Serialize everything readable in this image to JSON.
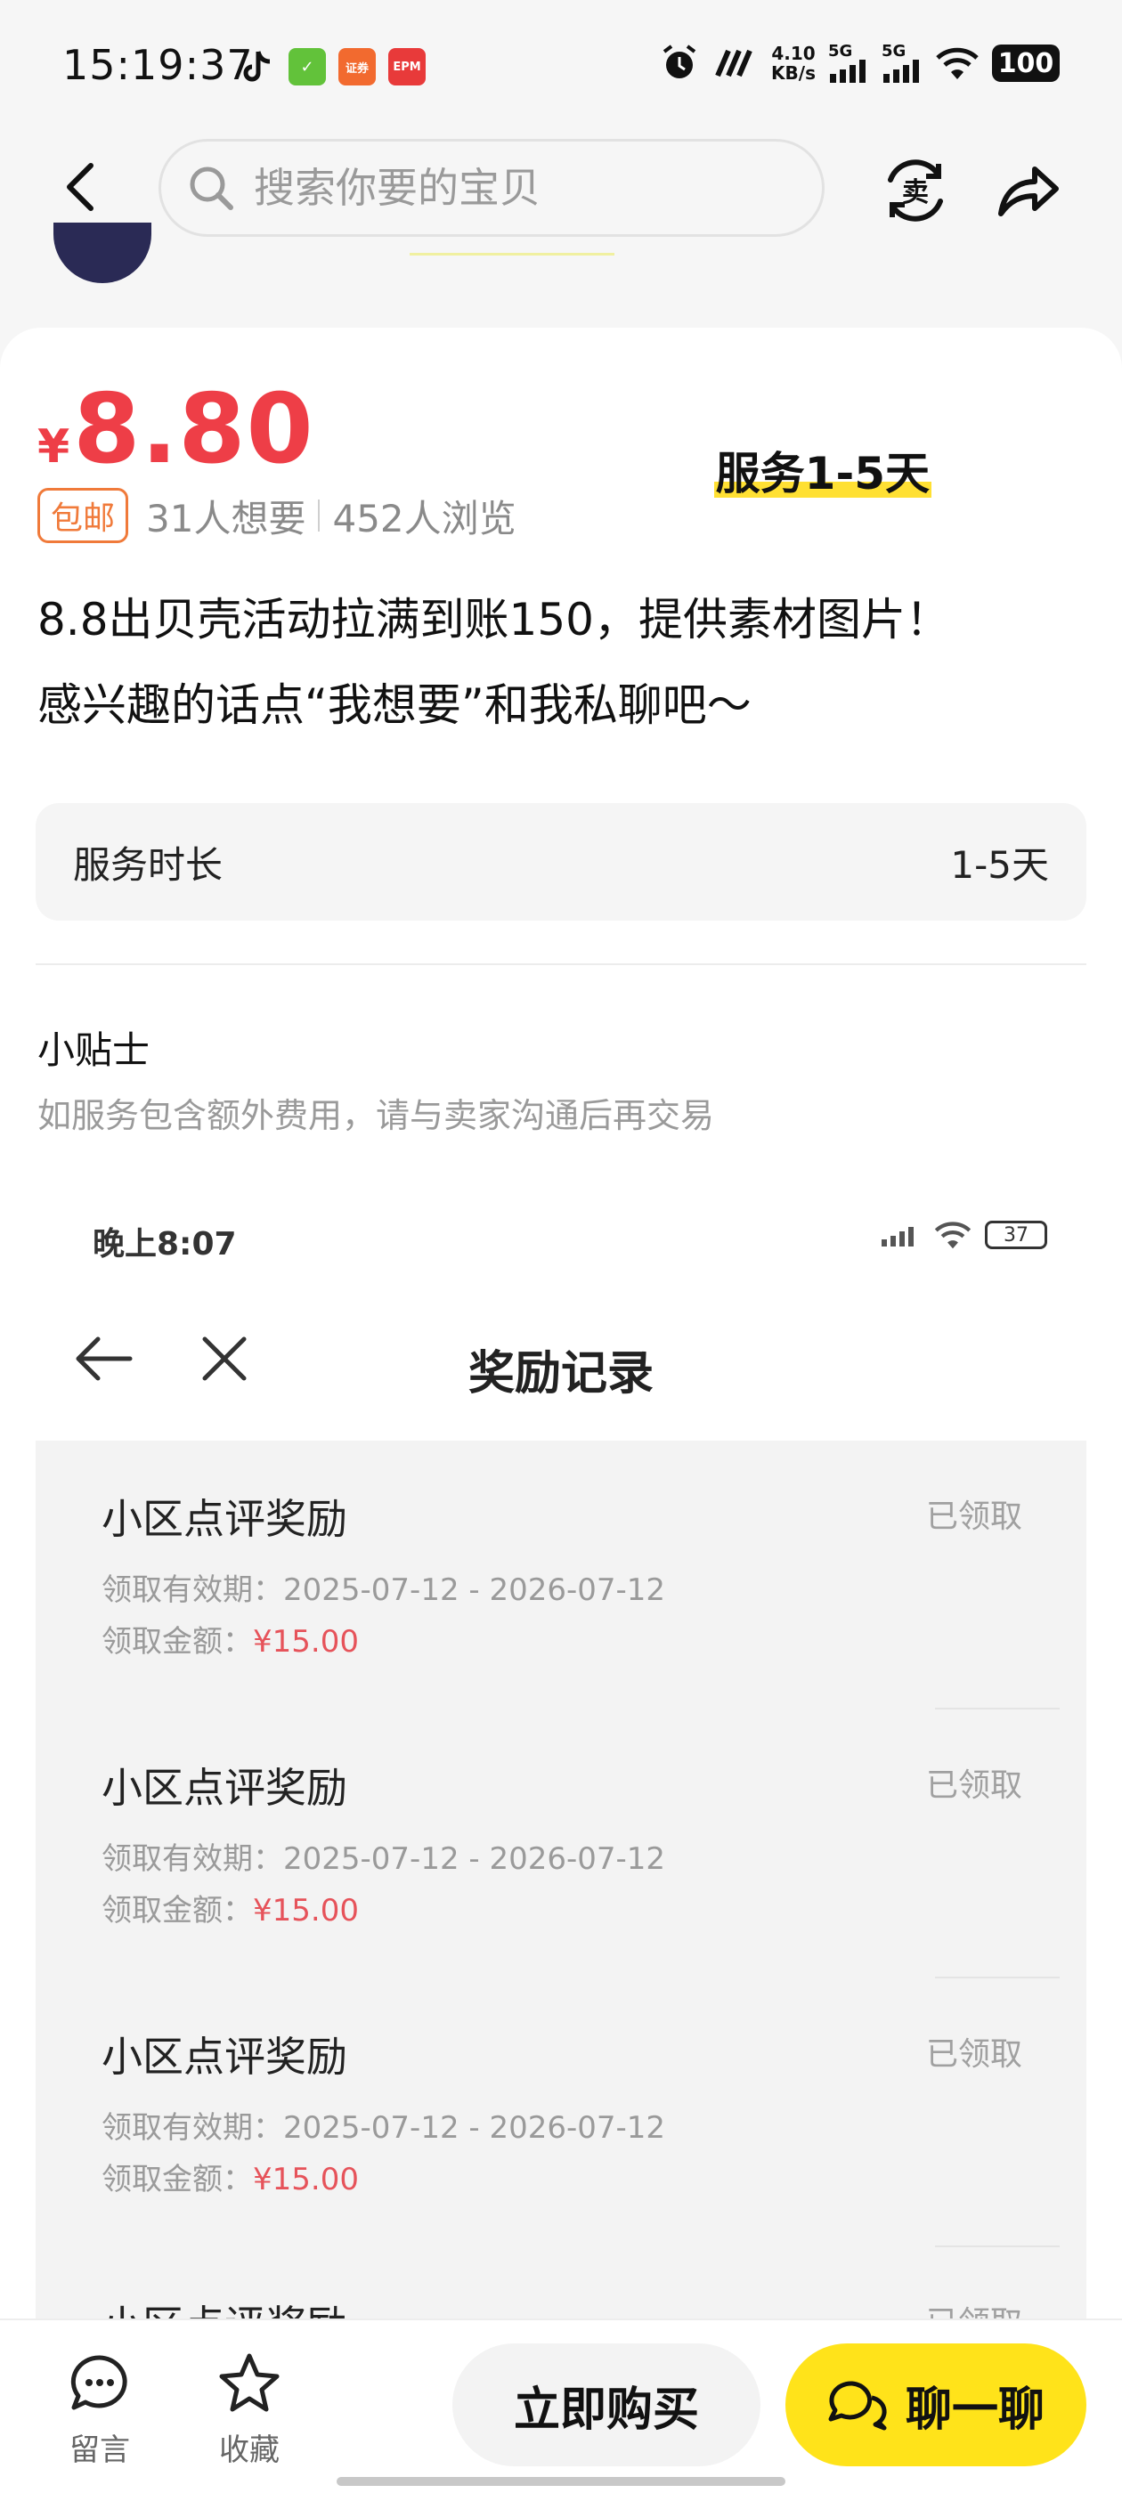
{
  "status_bar": {
    "time": "15:19:37",
    "net_speed_value": "4.10",
    "net_speed_unit": "KB/s",
    "sim1": "5G",
    "sim2": "5G",
    "battery": "100",
    "icons": [
      "tiktok-icon",
      "wechat-check-icon",
      "securities-app-icon",
      "epm-app-icon",
      "alarm-icon",
      "nfc-icon",
      "signal-icon",
      "signal-icon",
      "wifi-icon",
      "battery-icon"
    ]
  },
  "nav": {
    "search_placeholder": "搜索你要的宝贝",
    "icons": [
      "back-icon",
      "search-icon",
      "sell-icon",
      "share-icon"
    ]
  },
  "product": {
    "currency": "¥",
    "price": "8.80",
    "service_tag": "服务1-5天",
    "free_shipping": "包邮",
    "wants": "31人想要",
    "views": "452人浏览",
    "description_line1": "8.8出贝壳活动拉满到账150，提供素材图片！",
    "description_line2": "感兴趣的话点“我想要”和我私聊吧～"
  },
  "spec": {
    "label": "服务时长",
    "value": "1-5天"
  },
  "tips": {
    "title": "小贴士",
    "text": "如服务包含额外费用，请与卖家沟通后再交易"
  },
  "embedded_screenshot": {
    "time": "晚上8:07",
    "battery": "37",
    "title": "奖励记录",
    "records": [
      {
        "title": "小区点评奖励",
        "status": "已领取",
        "valid": "领取有效期：2025-07-12 - 2026-07-12",
        "amount_label": "领取金额：",
        "amount": "¥15.00"
      },
      {
        "title": "小区点评奖励",
        "status": "已领取",
        "valid": "领取有效期：2025-07-12 - 2026-07-12",
        "amount_label": "领取金额：",
        "amount": "¥15.00"
      },
      {
        "title": "小区点评奖励",
        "status": "已领取",
        "valid": "领取有效期：2025-07-12 - 2026-07-12",
        "amount_label": "领取金额：",
        "amount": "¥15.00"
      },
      {
        "title": "小区点评奖励",
        "status": "已领取"
      }
    ]
  },
  "bottom_bar": {
    "comment": "留言",
    "favorite": "收藏",
    "buy": "立即购买",
    "chat": "聊一聊"
  },
  "colors": {
    "price": "#ee3e47",
    "accent_yellow": "#ffe31a",
    "free_ship": "#f07a3a"
  }
}
